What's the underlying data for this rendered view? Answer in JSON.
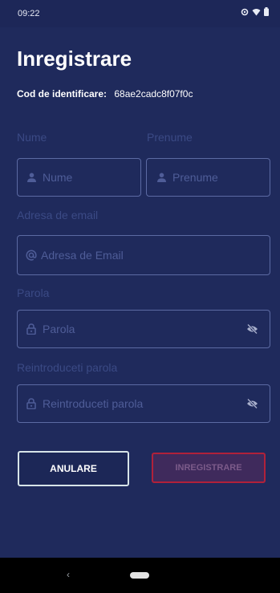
{
  "status_bar": {
    "time": "09:22"
  },
  "form": {
    "title": "Inregistrare",
    "id_label": "Cod de identificare:",
    "id_value": "68ae2cadc8f07f0c",
    "first_name_label": "Nume",
    "first_name_placeholder": "Nume",
    "last_name_label": "Prenume",
    "last_name_placeholder": "Prenume",
    "email_label": "Adresa de email",
    "email_placeholder": "Adresa de Email",
    "password_label": "Parola",
    "password_placeholder": "Parola",
    "confirm_label": "Reintroduceti parola",
    "confirm_placeholder": "Reintroduceti parola"
  },
  "buttons": {
    "cancel": "ANULARE",
    "register": "INREGISTRARE"
  },
  "colors": {
    "background": "#1f2a5c",
    "field_border": "#5c6aa3",
    "register_border": "#b0213a"
  },
  "icons": {
    "person": "person-icon",
    "at": "at-icon",
    "lock": "lock-icon",
    "eye_off": "eye-off-icon"
  }
}
